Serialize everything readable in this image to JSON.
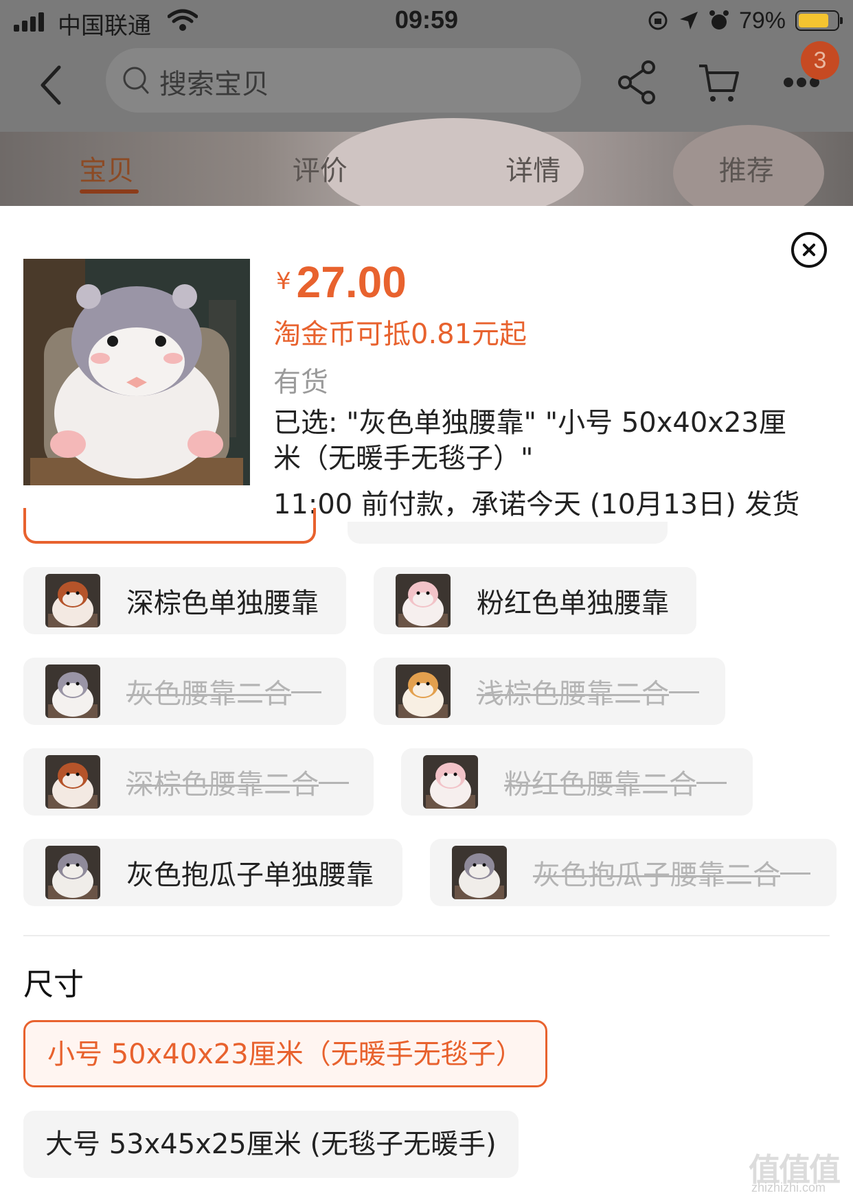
{
  "status_bar": {
    "carrier": "中国联通",
    "time": "09:59",
    "battery": "79%"
  },
  "nav": {
    "search_placeholder": "搜索宝贝",
    "badge_count": "3"
  },
  "tabs": [
    {
      "label": "宝贝",
      "active": true
    },
    {
      "label": "评价",
      "active": false
    },
    {
      "label": "详情",
      "active": false
    },
    {
      "label": "推荐",
      "active": false
    }
  ],
  "product": {
    "price_currency": "¥",
    "price": "27.00",
    "coin_text": "淘金币可抵0.81元起",
    "stock": "有货",
    "selected": "已选: \"灰色单独腰靠\" \"小号 50x40x23厘米（无暖手无毯子）\"",
    "shipping": "11:00 前付款，承诺今天 (10月13日) 发货"
  },
  "color_options": [
    {
      "label": "深棕色单独腰靠",
      "thumb": "dark-brown",
      "available": true
    },
    {
      "label": "粉红色单独腰靠",
      "thumb": "pink",
      "available": true
    },
    {
      "label": "灰色腰靠二合",
      "thumb": "gray",
      "available": false
    },
    {
      "label": "浅棕色腰靠二合",
      "thumb": "light-brown",
      "available": false
    },
    {
      "label": "深棕色腰靠二合",
      "thumb": "dark-brown",
      "available": false
    },
    {
      "label": "粉红色腰靠二合",
      "thumb": "pink",
      "available": false
    },
    {
      "label": "灰色抱瓜子单独腰靠",
      "thumb": "gray-seed",
      "available": true
    },
    {
      "label": "灰色抱瓜子腰靠二合",
      "thumb": "gray-seed",
      "available": false
    }
  ],
  "size_section": {
    "title": "尺寸",
    "options": [
      {
        "label": "小号 50x40x23厘米（无暖手无毯子）",
        "selected": true
      },
      {
        "label": "大号 53x45x25厘米 (无毯子无暖手)",
        "selected": false
      }
    ]
  },
  "watermark": {
    "main": "值值值",
    "sub": "zhizhizhi.com"
  },
  "colors": {
    "accent": "#e8622e",
    "option_bg": "#f4f4f4",
    "disabled_text": "#b4b4b4"
  }
}
